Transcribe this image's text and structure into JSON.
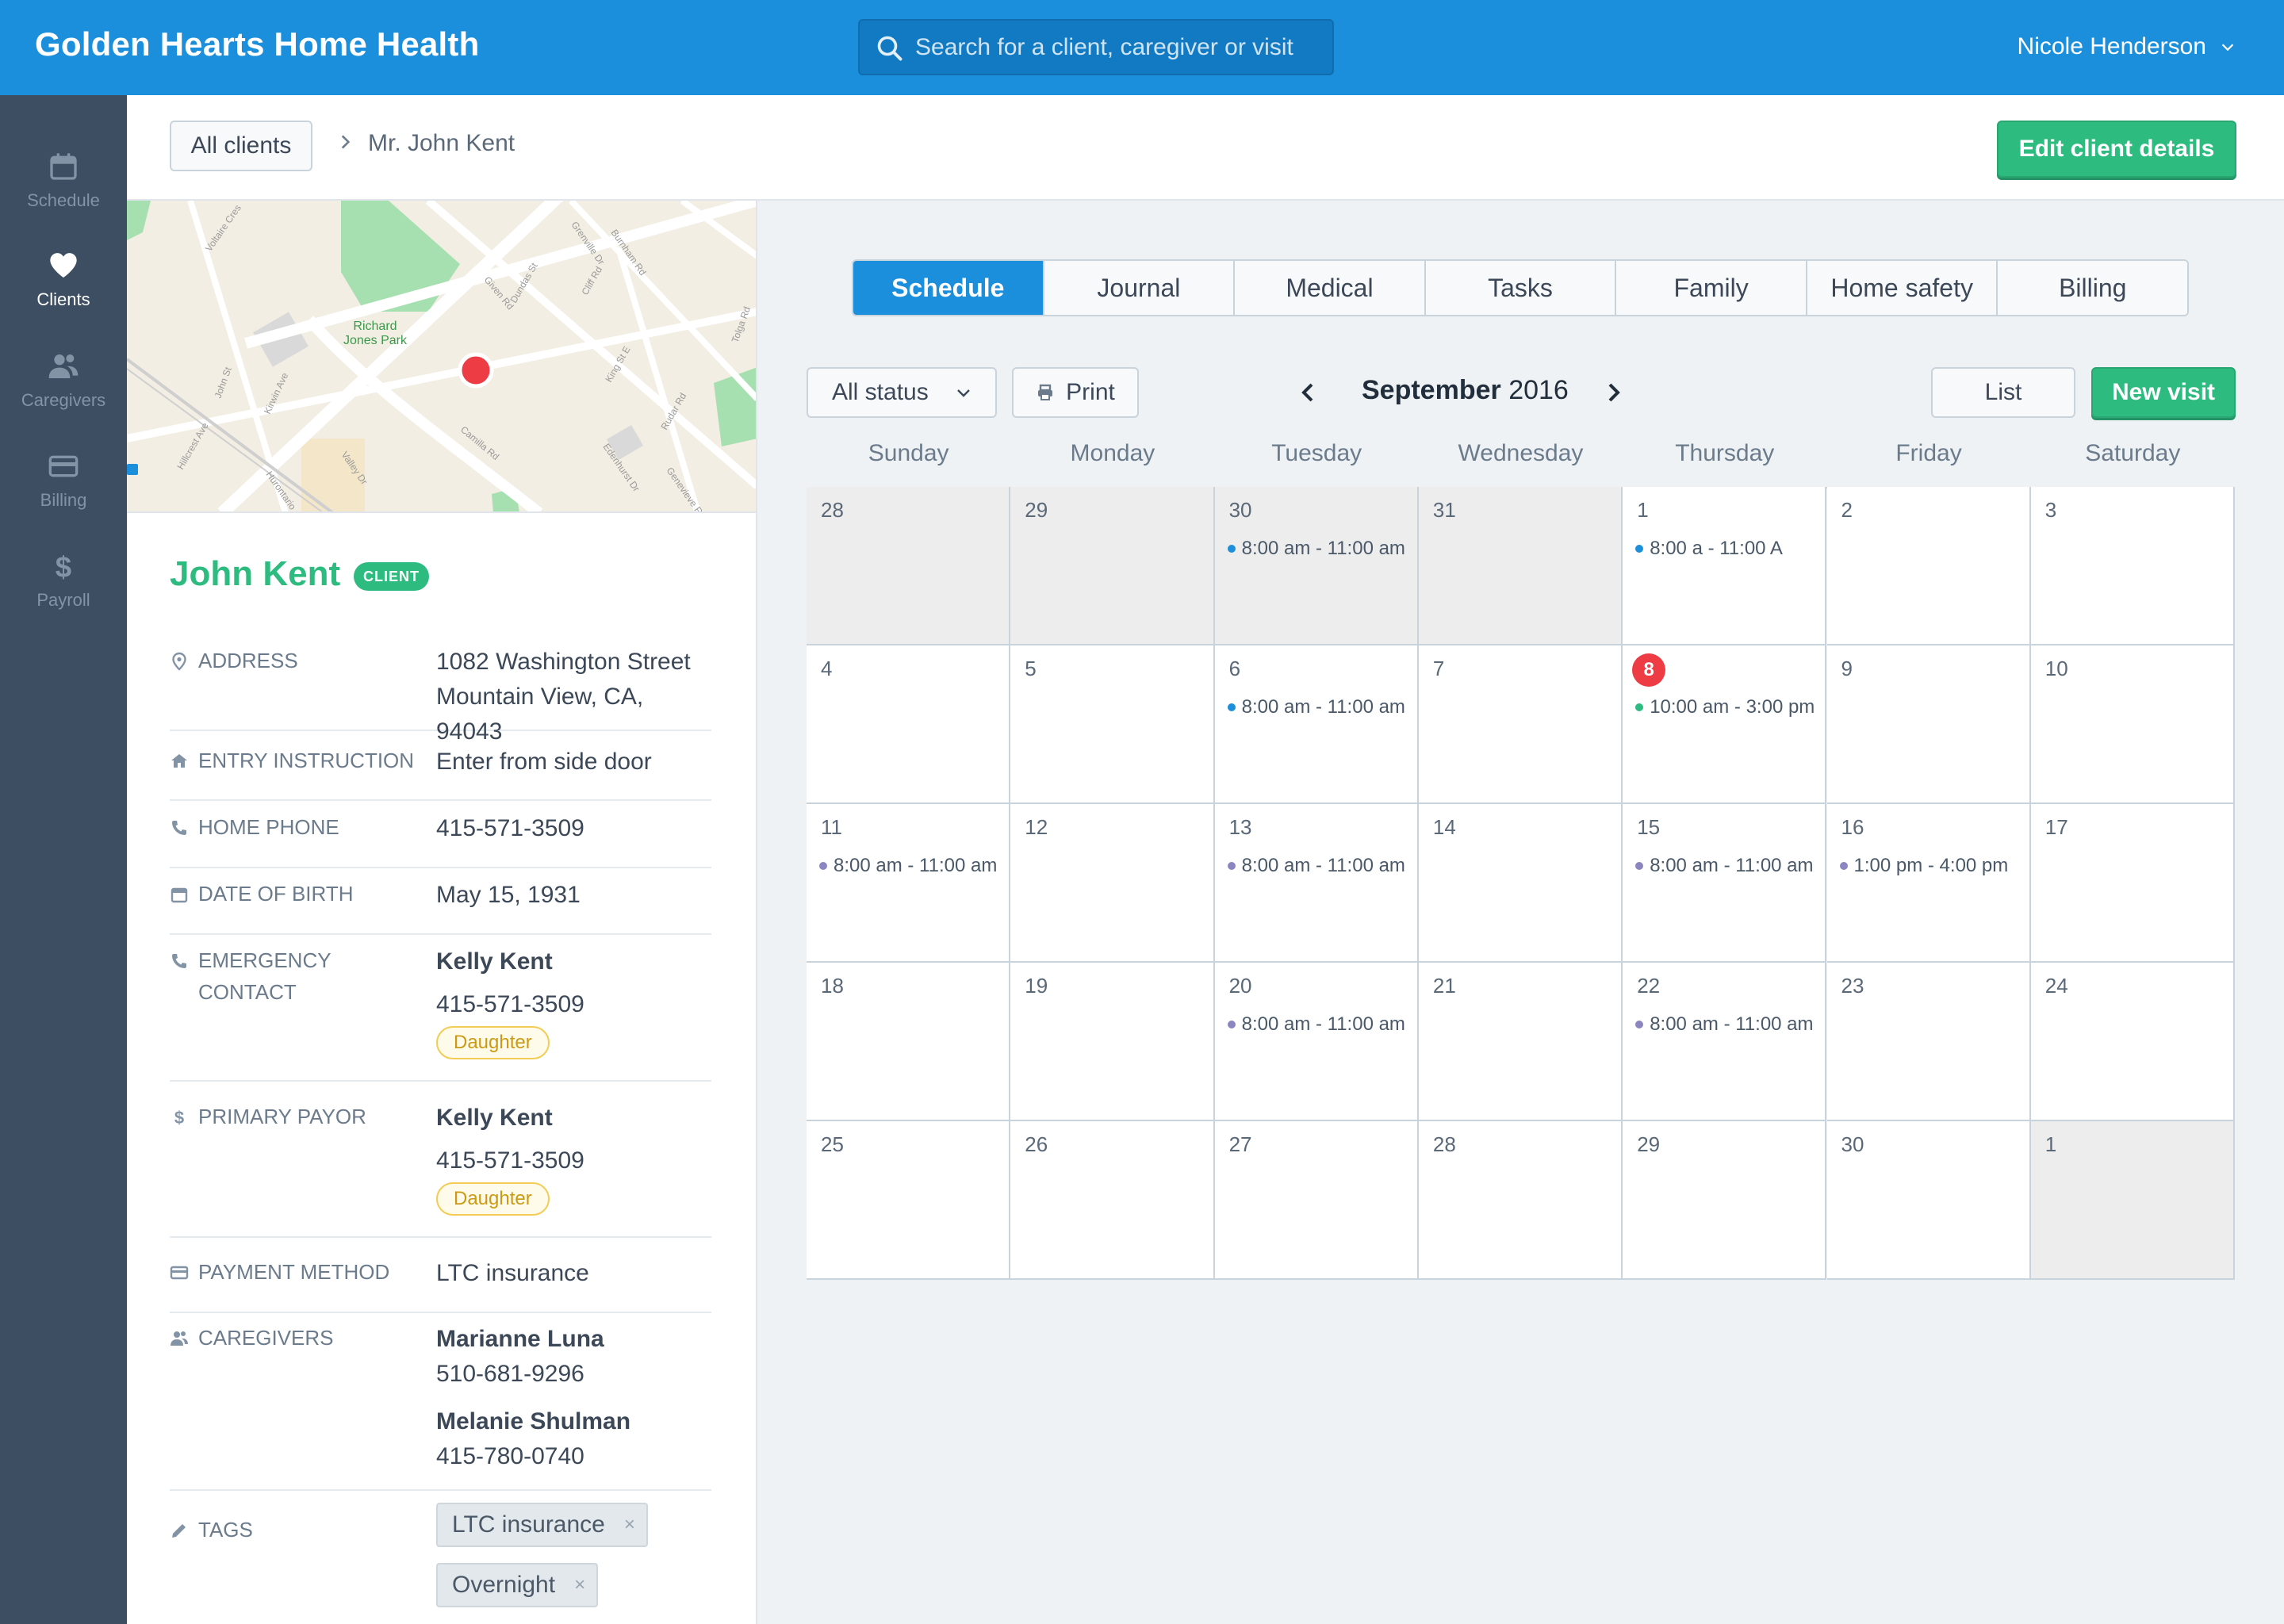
{
  "app": {
    "brand": "Golden Hearts Home Health",
    "search_placeholder": "Search for a client, caregiver or visit",
    "user_name": "Nicole Henderson"
  },
  "nav": [
    {
      "label": "Schedule",
      "icon": "calendar-icon",
      "active": false
    },
    {
      "label": "Clients",
      "icon": "heart-icon",
      "active": true
    },
    {
      "label": "Caregivers",
      "icon": "users-icon",
      "active": false
    },
    {
      "label": "Billing",
      "icon": "credit-card-icon",
      "active": false
    },
    {
      "label": "Payroll",
      "icon": "dollar-icon",
      "active": false
    }
  ],
  "breadcrumb": {
    "root": "All clients",
    "current": "Mr. John Kent",
    "edit_button": "Edit client details"
  },
  "map": {
    "park_label_1": "Richard",
    "park_label_2": "Jones Park",
    "streets": [
      "Voltaire Cres",
      "Grenville Dr",
      "Burnham Rd",
      "Given Rd",
      "Dundas St",
      "Cliff Rd",
      "King St E",
      "Tolga Rd",
      "Rudar Rd",
      "John St",
      "Kirwin Ave",
      "Hillcrest Ave",
      "Camilla Rd",
      "Edenhurst Dr",
      "Genevieve Rd",
      "Hurontario",
      "Valley Dr"
    ]
  },
  "client": {
    "name": "John Kent",
    "badge": "CLIENT",
    "fields": {
      "address": {
        "label": "Address",
        "line1": "1082 Washington Street",
        "line2": "Mountain View, CA, 94043"
      },
      "entry": {
        "label": "Entry Instruction",
        "value": "Enter from side door"
      },
      "phone": {
        "label": "Home Phone",
        "value": "415-571-3509"
      },
      "dob": {
        "label": "Date of Birth",
        "value": "May 15, 1931"
      },
      "emergency": {
        "label": "Emergency Contact",
        "name": "Kelly Kent",
        "phone": "415-571-3509",
        "relation": "Daughter"
      },
      "payor": {
        "label": "Primary Payor",
        "name": "Kelly Kent",
        "phone": "415-571-3509",
        "relation": "Daughter"
      },
      "payment": {
        "label": "Payment Method",
        "value": "LTC insurance"
      },
      "caregivers": {
        "label": "Caregivers",
        "list": [
          {
            "name": "Marianne Luna",
            "phone": "510-681-9296"
          },
          {
            "name": "Melanie Shulman",
            "phone": "415-780-0740"
          }
        ]
      },
      "tags": {
        "label": "Tags",
        "list": [
          "LTC insurance",
          "Overnight"
        ]
      }
    }
  },
  "tabs": [
    "Schedule",
    "Journal",
    "Medical",
    "Tasks",
    "Family",
    "Home safety",
    "Billing"
  ],
  "active_tab": "Schedule",
  "toolbar": {
    "status_filter": "All status",
    "print": "Print",
    "month": "September",
    "year": "2016",
    "list": "List",
    "new_visit": "New visit"
  },
  "weekdays": [
    "Sunday",
    "Monday",
    "Tuesday",
    "Wednesday",
    "Thursday",
    "Friday",
    "Saturday"
  ],
  "colors": {
    "brand": "#1b8fdb",
    "success": "#2ebb7f",
    "today": "#ee3c45",
    "visit_blue": "#1b8fdb",
    "visit_green": "#2ebb7f",
    "visit_purple": "#8b85c1"
  },
  "calendar": [
    [
      {
        "day": "28",
        "muted": true
      },
      {
        "day": "29",
        "muted": true
      },
      {
        "day": "30",
        "muted": true,
        "visit": "8:00 am - 11:00 am",
        "dot": "blue"
      },
      {
        "day": "31",
        "muted": true
      },
      {
        "day": "1",
        "visit": "8:00 a - 11:00 A",
        "dot": "blue"
      },
      {
        "day": "2"
      },
      {
        "day": "3"
      }
    ],
    [
      {
        "day": "4"
      },
      {
        "day": "5"
      },
      {
        "day": "6",
        "visit": "8:00 am - 11:00 am",
        "dot": "blue"
      },
      {
        "day": "7"
      },
      {
        "day": "8",
        "today": true,
        "visit": "10:00 am - 3:00 pm",
        "dot": "green"
      },
      {
        "day": "9"
      },
      {
        "day": "10"
      }
    ],
    [
      {
        "day": "11",
        "visit": "8:00 am - 11:00 am",
        "dot": "purple"
      },
      {
        "day": "12"
      },
      {
        "day": "13",
        "visit": "8:00 am - 11:00 am",
        "dot": "purple"
      },
      {
        "day": "14"
      },
      {
        "day": "15",
        "visit": "8:00 am - 11:00 am",
        "dot": "purple"
      },
      {
        "day": "16",
        "visit": "1:00 pm - 4:00 pm",
        "dot": "purple"
      },
      {
        "day": "17"
      }
    ],
    [
      {
        "day": "18"
      },
      {
        "day": "19"
      },
      {
        "day": "20",
        "visit": "8:00 am - 11:00 am",
        "dot": "purple"
      },
      {
        "day": "21"
      },
      {
        "day": "22",
        "visit": "8:00 am - 11:00 am",
        "dot": "purple"
      },
      {
        "day": "23"
      },
      {
        "day": "24"
      }
    ],
    [
      {
        "day": "25"
      },
      {
        "day": "26"
      },
      {
        "day": "27"
      },
      {
        "day": "28"
      },
      {
        "day": "29"
      },
      {
        "day": "30"
      },
      {
        "day": "1",
        "muted": true
      }
    ]
  ]
}
